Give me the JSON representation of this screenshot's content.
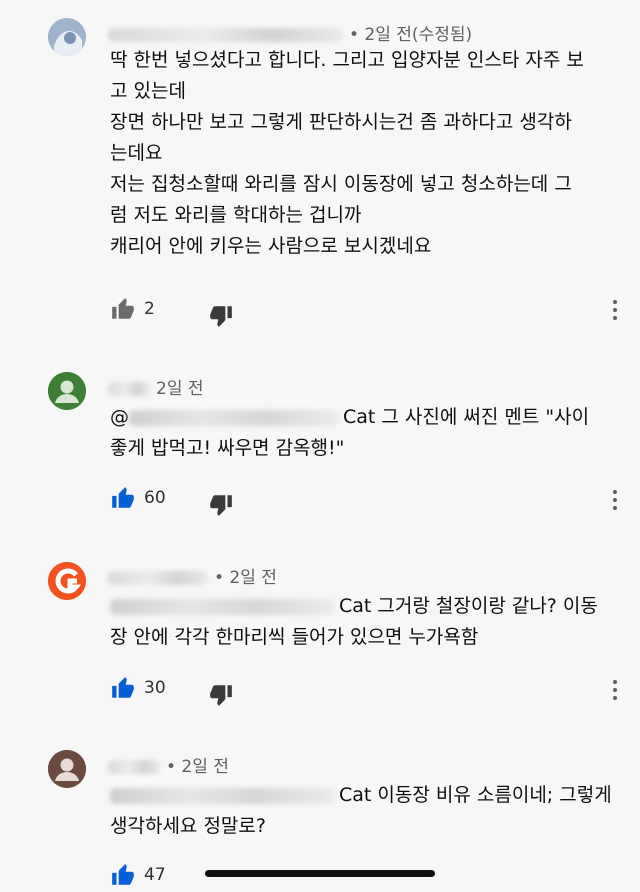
{
  "colors": {
    "accent_blue": "#065fd4",
    "muted_gray": "#606060",
    "avatar_blue": "#8fa7c9",
    "avatar_green": "#2e7d32",
    "avatar_orange": "#f4511e",
    "avatar_brown": "#6d4c41"
  },
  "comments": [
    {
      "meta": "• 2일 전(수정됨)",
      "lines": [
        "딱 한번 넣으셨다고 합니다. 그리고 입양자분 인스타 자주 보",
        "고 있는데",
        "장면 하나만 보고 그렇게 판단하시는건 좀 과하다고 생각하",
        "는데요",
        "저는 집청소할때 와리를 잠시 이동장에 넣고 청소하는데 그",
        "럼 저도 와리를 학대하는 겁니까",
        "캐리어 안에 키우는 사람으로 보시겠네요"
      ],
      "likes": "2",
      "liked": false
    },
    {
      "meta": "2일 전",
      "line1_visible": "Cat 그 사진에 써진 멘트 \"사이",
      "mention_prefix": "@",
      "lines_rest": [
        "좋게 밥먹고! 싸우면 감옥행!\""
      ],
      "likes": "60",
      "liked": true
    },
    {
      "meta": "• 2일 전",
      "line1_visible": "Cat 그거랑 철장이랑 같나? 이동",
      "lines_rest": [
        "장 안에 각각 한마리씩 들어가 있으면 누가욕함"
      ],
      "likes": "30",
      "liked": true
    },
    {
      "meta": "• 2일 전",
      "line1_visible": "Cat 이동장 비유 소름이네; 그렇게",
      "lines_rest": [
        "생각하세요 정말로?"
      ],
      "likes": "47",
      "liked": true
    }
  ],
  "icons": {
    "like": "thumbs-up-icon",
    "dislike": "thumbs-down-icon",
    "more": "more-vert-icon",
    "avatar": "person-icon"
  }
}
